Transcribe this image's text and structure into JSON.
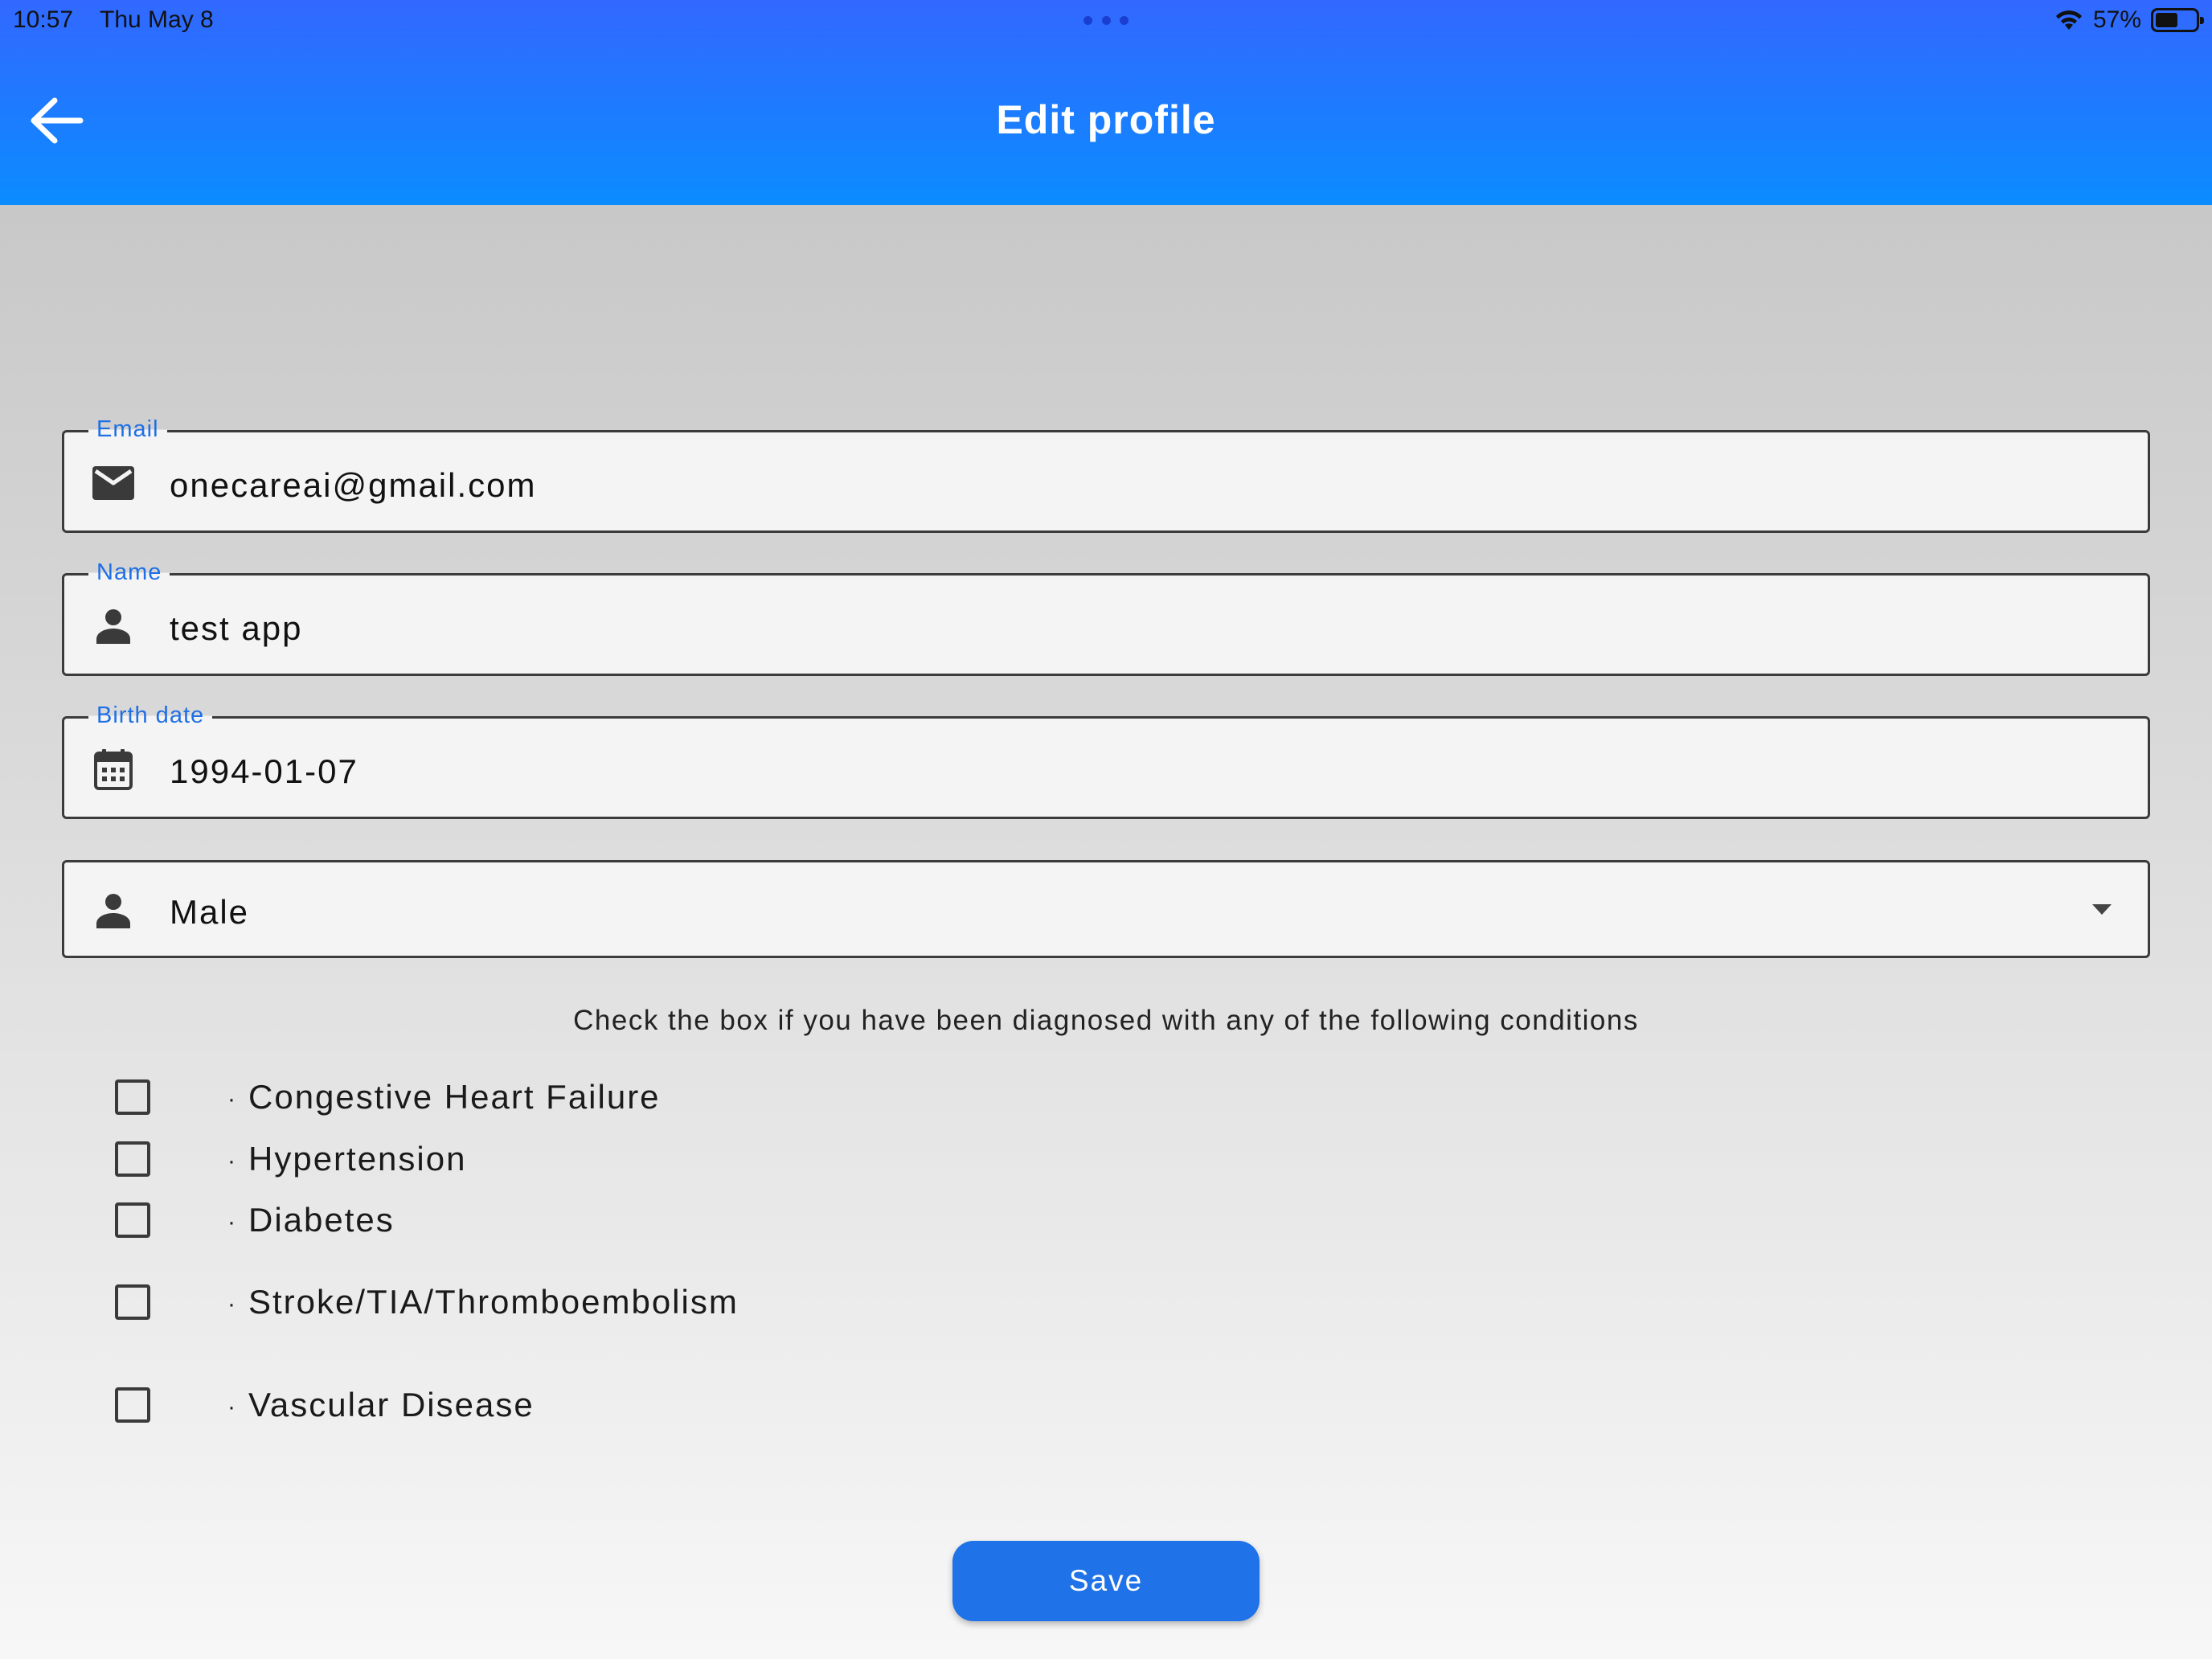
{
  "status_bar": {
    "time": "10:57",
    "date": "Thu May 8",
    "battery_text": "57%",
    "battery_level": 0.57
  },
  "header": {
    "title": "Edit profile",
    "back_icon": "arrow-left-icon",
    "gradient_top": "#3268ff",
    "gradient_bottom": "#0b8cff"
  },
  "form": {
    "email": {
      "label": "Email",
      "value": "onecareai@gmail.com",
      "icon": "envelope-icon"
    },
    "name": {
      "label": "Name",
      "value": "test app",
      "icon": "person-icon"
    },
    "birth_date": {
      "label": "Birth date",
      "value": "1994-01-07",
      "icon": "calendar-icon"
    },
    "gender": {
      "selected": "Male",
      "icon": "person-icon"
    }
  },
  "conditions": {
    "instructions": "Check the box if you have been diagnosed with any of the following conditions",
    "items": [
      {
        "label": "Congestive Heart Failure",
        "checked": false
      },
      {
        "label": "Hypertension",
        "checked": false
      },
      {
        "label": "Diabetes",
        "checked": false
      },
      {
        "label": "Stroke/TIA/Thromboembolism",
        "checked": false
      },
      {
        "label": "Vascular Disease",
        "checked": false
      }
    ]
  },
  "actions": {
    "save_label": "Save",
    "accent_color": "#1f72e8"
  }
}
